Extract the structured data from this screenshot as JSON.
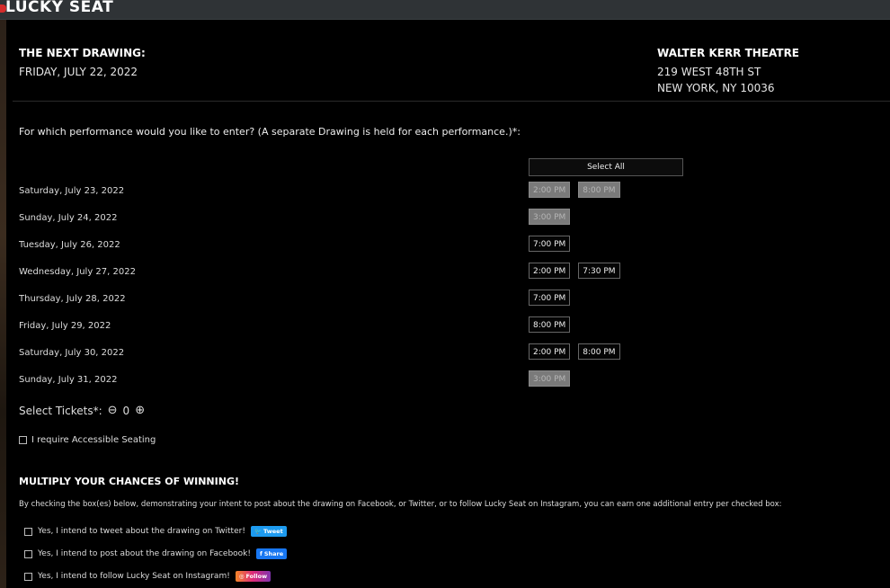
{
  "brand": {
    "logo_text": "LUCKY SEAT"
  },
  "drawing": {
    "title": "THE NEXT DRAWING:",
    "date": "FRIDAY, JULY 22, 2022"
  },
  "theatre": {
    "name": "WALTER KERR THEATRE",
    "address1": "219 WEST 48TH ST",
    "address2": "NEW YORK, NY 10036"
  },
  "question": "For which performance would you like to enter? (A separate Drawing is held for each performance.)*:",
  "select_all_label": "Select All",
  "performances": [
    {
      "date": "Saturday, July 23, 2022",
      "slots": [
        {
          "time": "2:00 PM",
          "disabled": true
        },
        {
          "time": "8:00 PM",
          "disabled": true
        }
      ]
    },
    {
      "date": "Sunday, July 24, 2022",
      "slots": [
        {
          "time": "3:00 PM",
          "disabled": true
        }
      ]
    },
    {
      "date": "Tuesday, July 26, 2022",
      "slots": [
        {
          "time": "7:00 PM",
          "disabled": false
        }
      ]
    },
    {
      "date": "Wednesday, July 27, 2022",
      "slots": [
        {
          "time": "2:00 PM",
          "disabled": false
        },
        {
          "time": "7:30 PM",
          "disabled": false
        }
      ]
    },
    {
      "date": "Thursday, July 28, 2022",
      "slots": [
        {
          "time": "7:00 PM",
          "disabled": false
        }
      ]
    },
    {
      "date": "Friday, July 29, 2022",
      "slots": [
        {
          "time": "8:00 PM",
          "disabled": false
        }
      ]
    },
    {
      "date": "Saturday, July 30, 2022",
      "slots": [
        {
          "time": "2:00 PM",
          "disabled": false
        },
        {
          "time": "8:00 PM",
          "disabled": false
        }
      ]
    },
    {
      "date": "Sunday, July 31, 2022",
      "slots": [
        {
          "time": "3:00 PM",
          "disabled": true
        }
      ]
    }
  ],
  "tickets": {
    "label": "Select Tickets*:",
    "minus_icon": "⊖",
    "count": "0",
    "plus_icon": "⊕"
  },
  "accessible_label": "I require Accessible Seating",
  "multiply": {
    "title": "MULTIPLY YOUR CHANCES OF WINNING!",
    "description": "By checking the box(es) below, demonstrating your intent to post about the drawing on Facebook, or Twitter, or to follow Lucky Seat on Instagram, you can earn one additional entry per checked box:",
    "twitter": {
      "label": "Yes, I intend to tweet about the drawing on Twitter!",
      "button": "Tweet"
    },
    "facebook": {
      "label": "Yes, I intend to post about the drawing on Facebook!",
      "button": "Share"
    },
    "instagram": {
      "label": "Yes, I intend to follow Lucky Seat on Instagram!",
      "button": "Follow"
    }
  },
  "colors": {
    "background": "#000000",
    "topbar": "#2f3336",
    "logo_accent": "#d42c2c",
    "disabled_slot": "#7a7a7a"
  }
}
